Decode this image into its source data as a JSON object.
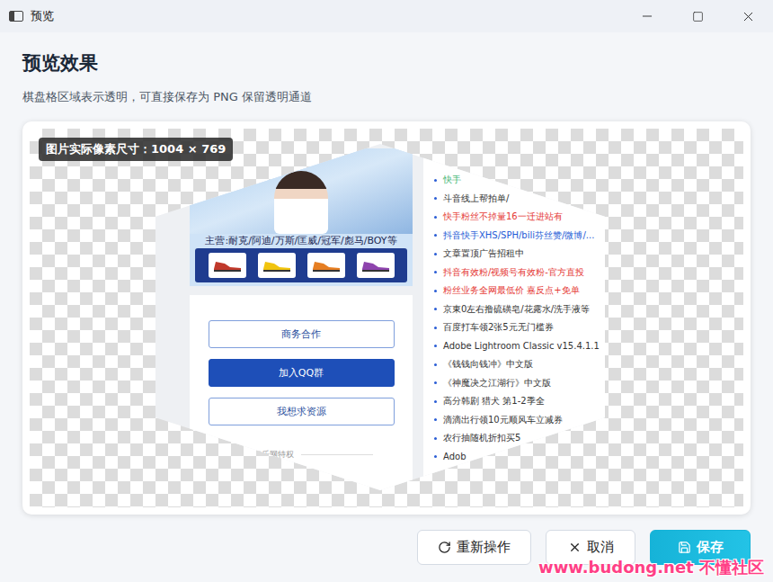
{
  "window": {
    "title": "预览"
  },
  "heading": "预览效果",
  "subtitle": "棋盘格区域表示透明，可直接保存为 PNG 保留透明通道",
  "badge": "图片实际像素尺寸：1004 × 769",
  "preview": {
    "banner_caption": "主营:耐克/阿迪/万斯/匡威/冠军/彪马/BOY等",
    "menu_buttons": [
      {
        "label": "商务合作",
        "kind": "outline"
      },
      {
        "label": "加入QQ群",
        "kind": "filled"
      },
      {
        "label": "我想求资源",
        "kind": "outline"
      }
    ],
    "divider_text": "新小刀娱乐网特权",
    "list": [
      {
        "text": "快手",
        "color": "#3cb371"
      },
      {
        "text": "斗音线上帮拍单/",
        "color": "#333333"
      },
      {
        "text": "快手粉丝不掉量16一迁进站有",
        "color": "#e53935"
      },
      {
        "text": "抖音快手XHS/SPH/bili芬丝赞/微博/...",
        "color": "#1e5bd6"
      },
      {
        "text": "文章置顶广告招租中",
        "color": "#333333"
      },
      {
        "text": "抖音有效粉/视频号有效粉-官方直投",
        "color": "#e53935"
      },
      {
        "text": "粉丝业务全网最低价 嘉反点+免单",
        "color": "#e53935"
      },
      {
        "text": "京東0左右撸硫磺皂/花露水/洗手液等",
        "color": "#333333"
      },
      {
        "text": "百度打车领2张5元无门槛券",
        "color": "#333333"
      },
      {
        "text": "Adobe Lightroom Classic v15.4.1.1",
        "color": "#333333"
      },
      {
        "text": "《钱钱向钱冲》中文版",
        "color": "#333333"
      },
      {
        "text": "《神魔决之江湖行》中文版",
        "color": "#333333"
      },
      {
        "text": "高分韩剧 猎犬 第1-2季全",
        "color": "#333333"
      },
      {
        "text": "滴滴出行领10元顺风车立减券",
        "color": "#333333"
      },
      {
        "text": "农行抽随机折扣买5",
        "color": "#333333"
      },
      {
        "text": "Adob",
        "color": "#333333"
      }
    ]
  },
  "buttons": [
    {
      "label": "重新操作",
      "kind": "retry"
    },
    {
      "label": "取消",
      "kind": "cancel"
    },
    {
      "label": "保存",
      "kind": "save"
    }
  ],
  "watermark": "www.budong.net 不懂社区"
}
